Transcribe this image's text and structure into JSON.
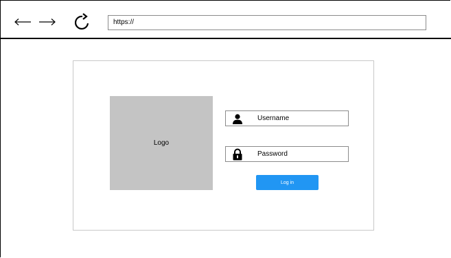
{
  "browser": {
    "url": "https://",
    "back_icon": "left-arrow-icon",
    "forward_icon": "right-arrow-icon",
    "reload_icon": "reload-icon"
  },
  "login": {
    "logo_text": "Logo",
    "username_label": "Username",
    "username_icon": "user-icon",
    "password_label": "Password",
    "password_icon": "lock-icon",
    "login_button_label": "Log in"
  },
  "colors": {
    "button": "#2196f3",
    "logo_placeholder": "#c4c4c4",
    "panel_border": "#c8c8c8"
  }
}
